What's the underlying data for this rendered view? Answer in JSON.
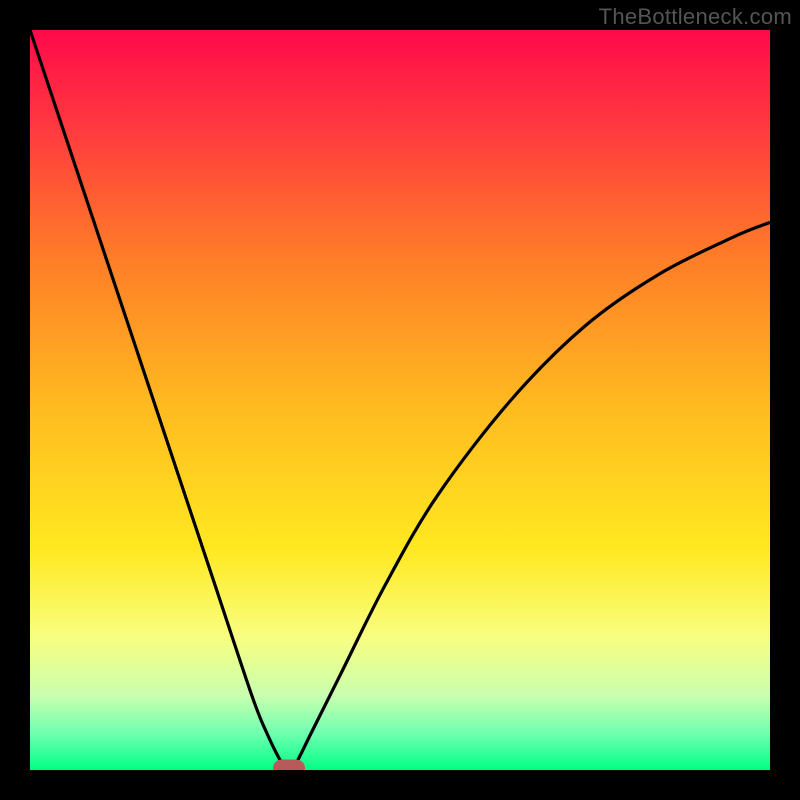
{
  "watermark": "TheBottleneck.com",
  "chart_data": {
    "type": "line",
    "title": "",
    "xlabel": "",
    "ylabel": "",
    "xlim": [
      0,
      100
    ],
    "ylim": [
      0,
      100
    ],
    "series": [
      {
        "name": "bottleneck-curve",
        "x": [
          0,
          5,
          10,
          15,
          20,
          25,
          30,
          32,
          34,
          35,
          36,
          38,
          42,
          48,
          55,
          65,
          75,
          85,
          95,
          100
        ],
        "y": [
          100,
          85,
          70,
          55,
          40,
          25,
          10,
          5,
          1,
          0,
          1,
          5,
          13,
          25,
          37,
          50,
          60,
          67,
          72,
          74
        ]
      }
    ],
    "gradient_stops": [
      {
        "offset": 0,
        "color": "#ff0a4a"
      },
      {
        "offset": 12,
        "color": "#ff3540"
      },
      {
        "offset": 30,
        "color": "#ff7a28"
      },
      {
        "offset": 50,
        "color": "#ffb820"
      },
      {
        "offset": 70,
        "color": "#ffe820"
      },
      {
        "offset": 82,
        "color": "#f8ff80"
      },
      {
        "offset": 90,
        "color": "#c8ffb0"
      },
      {
        "offset": 95,
        "color": "#70ffb0"
      },
      {
        "offset": 100,
        "color": "#00ff85"
      }
    ],
    "marker": {
      "x": 35,
      "y": 0,
      "color": "#b85a5a"
    }
  }
}
